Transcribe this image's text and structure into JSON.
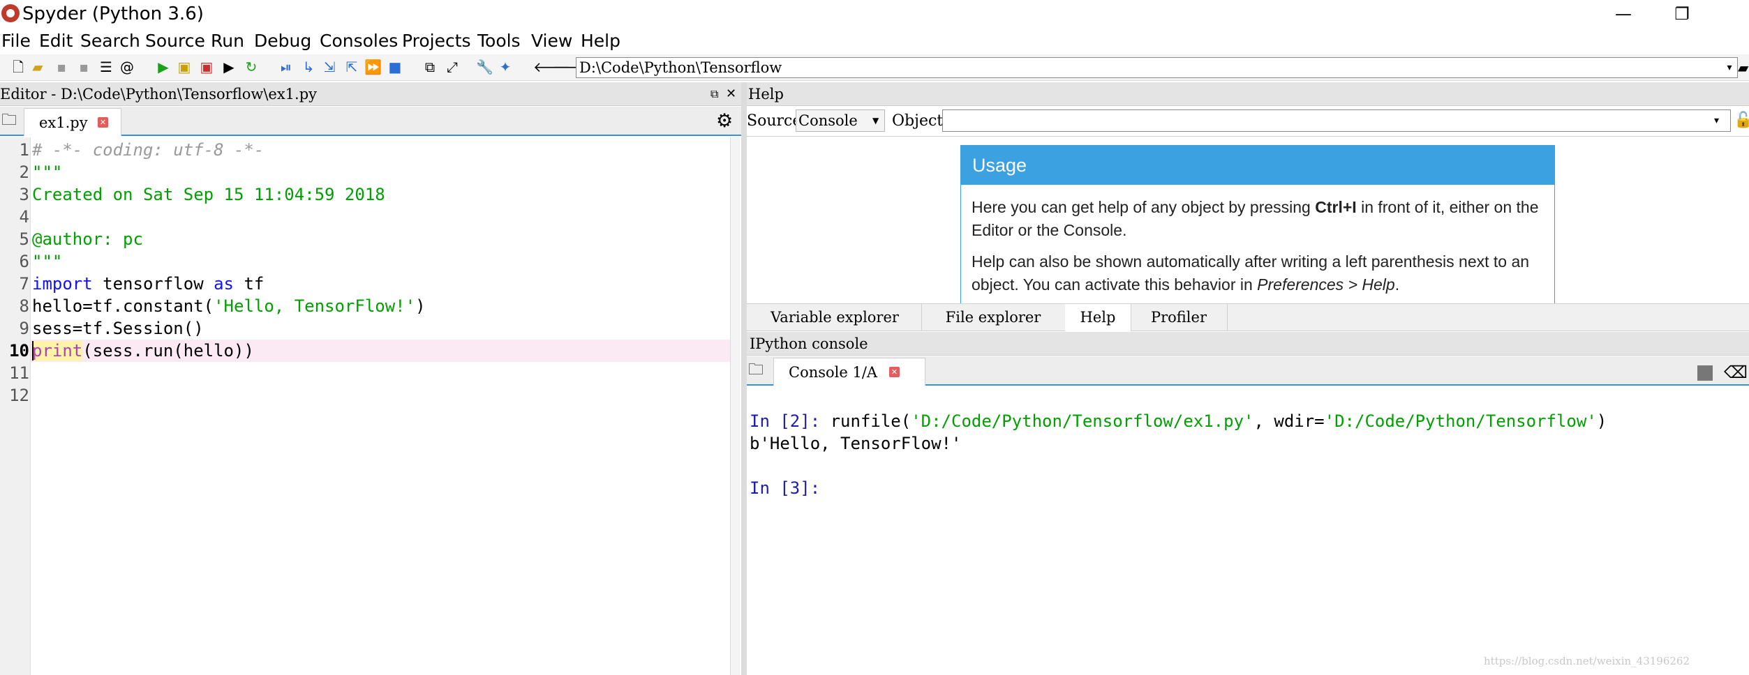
{
  "window": {
    "title": "Spyder (Python 3.6)"
  },
  "menu": [
    "File",
    "Edit",
    "Search",
    "Source",
    "Run",
    "Debug",
    "Consoles",
    "Projects",
    "Tools",
    "View",
    "Help"
  ],
  "toolbar": {
    "working_directory": "D:\\Code\\Python\\Tensorflow"
  },
  "editor": {
    "title": "Editor - D:\\Code\\Python\\Tensorflow\\ex1.py",
    "tab": "ex1.py",
    "current_line": 10,
    "line_numbers": [
      "1",
      "2",
      "3",
      "4",
      "5",
      "6",
      "7",
      "8",
      "9",
      "10",
      "11",
      "12"
    ],
    "code": {
      "l1": "# -*- coding: utf-8 -*-",
      "l2": "\"\"\"",
      "l3": "Created on Sat Sep 15 11:04:59 2018",
      "l5": "@author: pc",
      "l6": "\"\"\"",
      "l7_kw1": "import",
      "l7_mod": " tensorflow ",
      "l7_kw2": "as",
      "l7_alias": " tf",
      "l8_a": "hello=tf.constant(",
      "l8_str": "'Hello, TensorFlow!'",
      "l8_b": ")",
      "l9": "sess=tf.Session()",
      "l10_fn": "print",
      "l10_rest": "(sess.run(hello))"
    }
  },
  "help": {
    "title": "Help",
    "source_label": "Source",
    "source_value": "Console",
    "object_label": "Object",
    "usage_title": "Usage",
    "p1_a": "Here you can get help of any object by pressing ",
    "p1_b": "Ctrl+I",
    "p1_c": " in front of it, either on the Editor or the Console.",
    "p2_a": "Help can also be shown automatically after writing a left parenthesis next to an object. You can activate this behavior in ",
    "p2_b": "Preferences > Help",
    "p2_c": "."
  },
  "pane_tabs": [
    "Variable explorer",
    "File explorer",
    "Help",
    "Profiler"
  ],
  "ipython": {
    "title": "IPython console",
    "tab": "Console 1/A",
    "in2_prompt": "In [2]:",
    "in2_cmd": " runfile(",
    "in2_path": "'D:/Code/Python/Tensorflow/ex1.py'",
    "in2_mid": ", wdir=",
    "in2_wdir": "'D:/Code/Python/Tensorflow'",
    "in2_end": ")",
    "out2": "b'Hello, TensorFlow!'",
    "in3_prompt": "In [3]:"
  },
  "watermark": "https://blog.csdn.net/weixin_43196262"
}
